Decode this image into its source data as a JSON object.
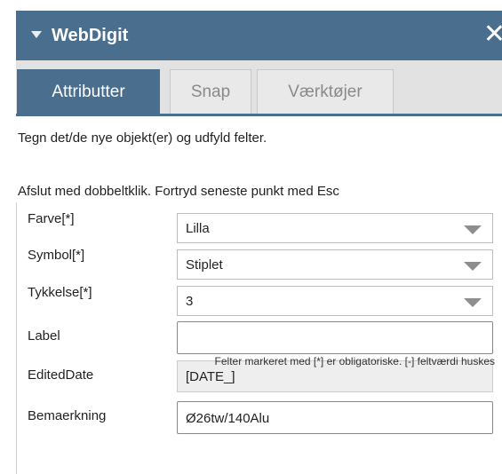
{
  "header": {
    "title": "WebDigit"
  },
  "tabs": [
    {
      "label": "Attributter",
      "active": true
    },
    {
      "label": "Snap",
      "active": false
    },
    {
      "label": "Værktøjer",
      "active": false
    }
  ],
  "instructions": {
    "line1": "Tegn det/de nye objekt(er) og udfyld felter.",
    "line2": "Afslut med dobbeltklik. Fortryd seneste punkt med Esc"
  },
  "form": {
    "farve": {
      "label": "Farve[*]",
      "value": "Lilla"
    },
    "symbol": {
      "label": "Symbol[*]",
      "value": "Stiplet"
    },
    "tykkelse": {
      "label": "Tykkelse[*]",
      "value": "3"
    },
    "label": {
      "label": "Label",
      "value": ""
    },
    "edited_date": {
      "label": "EditedDate",
      "value": "[DATE_]"
    },
    "bemaerkning": {
      "label": "Bemaerkning",
      "value": "Ø26tw/140Alu"
    }
  },
  "footnote": "Felter markeret med [*] er obligatoriske. [-] feltværdi huskes",
  "colors": {
    "accent": "#4a6f8e",
    "tabbar": "#e2e2e2"
  }
}
